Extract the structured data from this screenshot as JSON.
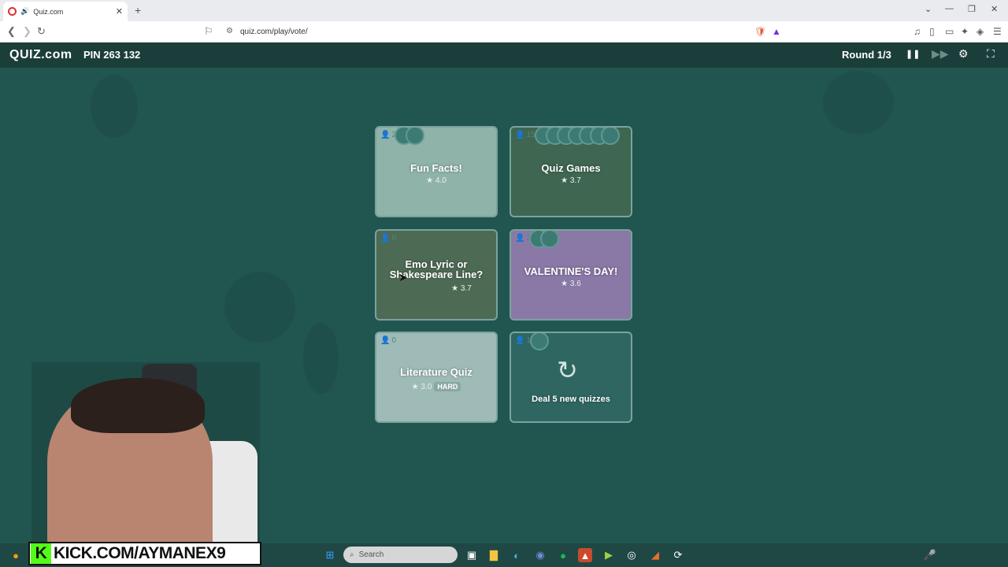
{
  "browser": {
    "tab_title": "Quiz.com",
    "url": "quiz.com/play/vote/"
  },
  "header": {
    "logo": "QUIZ.com",
    "pin": "PIN 263 132",
    "round": "Round 1/3"
  },
  "cards": [
    {
      "title": "Fun Facts!",
      "rating": "★ 4.0",
      "votes": "2",
      "voters": 2,
      "bg": "#8fb3a9"
    },
    {
      "title": "Quiz Games",
      "rating": "★ 3.7",
      "votes": "15",
      "voters": 7,
      "bg": "#3f6650"
    },
    {
      "title": "Emo Lyric or Shakespeare Line?",
      "rating": "★ 3.7",
      "votes": "0",
      "voters": 0,
      "bg": "#4d6a55"
    },
    {
      "title": "VALENTINE'S DAY!",
      "rating": "★ 3.6",
      "votes": "2",
      "voters": 2,
      "bg": "#8a78a6"
    },
    {
      "title": "Literature Quiz",
      "rating": "★ 3.0",
      "badge": "HARD",
      "votes": "0",
      "voters": 0,
      "bg": "#9fbbb7"
    },
    {
      "title": "Deal 5 new quizzes",
      "rating": "",
      "votes": "1",
      "voters": 1,
      "bg": "#2f6661"
    }
  ],
  "stream": {
    "kick_text": "KICK.COM/AYMANEX9"
  },
  "taskbar": {
    "search_placeholder": "Search"
  }
}
